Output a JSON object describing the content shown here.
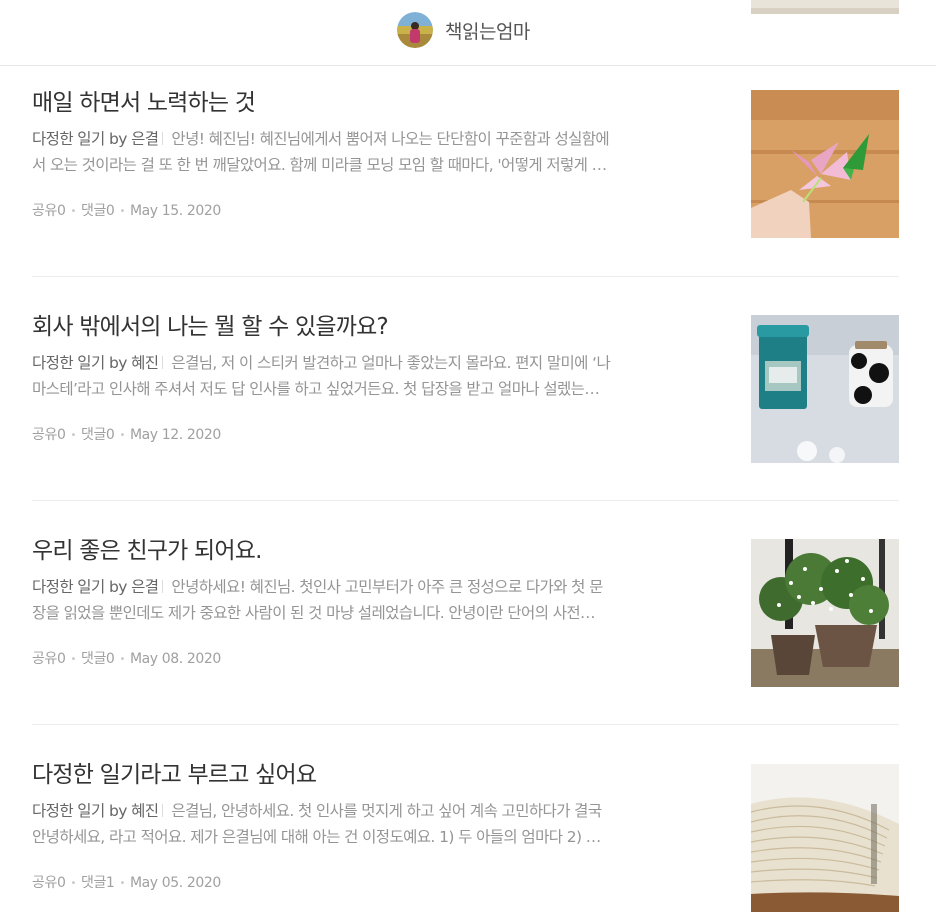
{
  "header": {
    "author_name": "책읽는엄마",
    "avatar_icon": "profile-avatar-icon"
  },
  "posts": [
    {
      "title": "매일 하면서 노력하는 것",
      "magazine": "다정한 일기 by 은결",
      "excerpt_line1": "안녕! 혜진님! 혜진님에게서 뿜어져 나오는 단단함이 꾸준함과 성실함에",
      "excerpt_line2": "서 오는 것이라는 걸 또 한 번 깨달았어요. 함께 미라클 모닝 모임 할 때마다, '어떻게 저렇게 …",
      "shares": "공유0",
      "comments": "댓글0",
      "date": "May 15. 2020",
      "thumb_icon": "origami-flower-photo"
    },
    {
      "title": "회사 밖에서의 나는 뭘 할 수 있을까요?",
      "magazine": "다정한 일기 by 혜진",
      "excerpt_line1": "은결님, 저 이 스티커 발견하고 얼마나 좋았는지 몰라요. 편지 말미에 ‘나",
      "excerpt_line2": "마스테’라고 인사해 주셔서 저도 답 인사를 하고 싶었거든요. 첫 답장을 받고 얼마나 설렜는…",
      "shares": "공유0",
      "comments": "댓글0",
      "date": "May 12. 2020",
      "thumb_icon": "tea-tin-and-mug-photo"
    },
    {
      "title": "우리 좋은 친구가 되어요.",
      "magazine": "다정한 일기 by 은결",
      "excerpt_line1": "안녕하세요! 혜진님. 첫인사 고민부터가 아주 큰 정성으로 다가와 첫 문",
      "excerpt_line2": "장을 읽었을 뿐인데도 제가 중요한 사람이 된 것 마냥 설레었습니다. 안녕이란 단어의 사전…",
      "shares": "공유0",
      "comments": "댓글0",
      "date": "May 08. 2020",
      "thumb_icon": "flower-pots-photo"
    },
    {
      "title": "다정한 일기라고 부르고 싶어요",
      "magazine": "다정한 일기 by 혜진",
      "excerpt_line1": "은결님, 안녕하세요. 첫 인사를 멋지게 하고 싶어 계속 고민하다가 결국",
      "excerpt_line2": "안녕하세요, 라고 적어요. 제가 은결님에 대해 아는 건 이정도예요. 1) 두 아들의 엄마다 2) …",
      "shares": "공유0",
      "comments": "댓글1",
      "date": "May 05. 2020",
      "thumb_icon": "open-book-photo"
    }
  ]
}
